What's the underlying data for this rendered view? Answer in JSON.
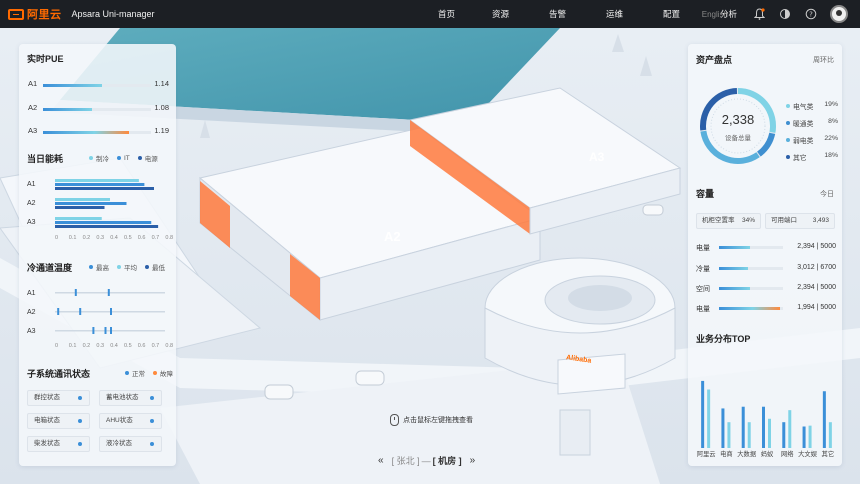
{
  "header": {
    "logo_text": "阿里云",
    "product_name": "Apsara Uni-manager",
    "nav": [
      "首页",
      "资源",
      "告警",
      "运维",
      "配置",
      "分析"
    ],
    "language": "English"
  },
  "left": {
    "pue": {
      "title": "实时PUE",
      "rows": [
        {
          "label": "A1",
          "value": "1.14",
          "fraction": 0.55
        },
        {
          "label": "A2",
          "value": "1.08",
          "fraction": 0.45
        },
        {
          "label": "A3",
          "value": "1.19",
          "fraction": 0.8
        }
      ]
    },
    "energy": {
      "title": "当日能耗",
      "legend": [
        "制冷",
        "IT",
        "电源"
      ],
      "rows": [
        {
          "label": "A1",
          "values": [
            0.61,
            0.65,
            0.72
          ]
        },
        {
          "label": "A2",
          "values": [
            0.4,
            0.52,
            0.36
          ]
        },
        {
          "label": "A3",
          "values": [
            0.34,
            0.7,
            0.75
          ]
        }
      ],
      "ticks": [
        "0",
        "0.1",
        "0.2",
        "0.3",
        "0.4",
        "0.5",
        "0.6",
        "0.7",
        "0.8"
      ]
    },
    "cold_aisle": {
      "title": "冷通道温度",
      "legend": [
        "最高",
        "平均",
        "最低"
      ],
      "rows": [
        {
          "label": "A1",
          "markers": [
            0.18,
            0.48
          ]
        },
        {
          "label": "A2",
          "markers": [
            0.02,
            0.22,
            0.5
          ]
        },
        {
          "label": "A3",
          "markers": [
            0.34,
            0.45,
            0.5
          ]
        }
      ],
      "ticks": [
        "0",
        "0.1",
        "0.2",
        "0.3",
        "0.4",
        "0.5",
        "0.6",
        "0.7",
        "0.8"
      ]
    },
    "subsystem": {
      "title": "子系统通讯状态",
      "legend": [
        "正常",
        "故障"
      ],
      "items": [
        "群控状态",
        "蓄电池状态",
        "电箱状态",
        "AHU状态",
        "柴发状态",
        "液冷状态"
      ]
    }
  },
  "right": {
    "assets": {
      "title": "资产盘点",
      "toggle": "周环比",
      "total": "2,338",
      "total_label": "设备总量",
      "legend": [
        {
          "name": "电气类",
          "pct": "19%",
          "value": 19,
          "color": "#7fd3e6"
        },
        {
          "name": "暖通类",
          "pct": "8%",
          "value": 8,
          "color": "#3f8fd0"
        },
        {
          "name": "弱电类",
          "pct": "22%",
          "value": 22,
          "color": "#5ab0dc"
        },
        {
          "name": "其它",
          "pct": "18%",
          "value": 18,
          "color": "#2b5fa8"
        }
      ]
    },
    "capacity": {
      "title": "容量",
      "period": "今日",
      "boxes": [
        {
          "label": "机柜空置率",
          "value": "34%"
        },
        {
          "label": "可用端口",
          "value": "3,493"
        }
      ],
      "rows": [
        {
          "label": "电量",
          "value": "2,394 | 5000",
          "fraction": 0.48
        },
        {
          "label": "冷量",
          "value": "3,012 | 6700",
          "fraction": 0.45
        },
        {
          "label": "空间",
          "value": "2,394 | 5000",
          "fraction": 0.48
        },
        {
          "label": "电量",
          "value": "1,994 | 5000",
          "fraction": 0.95
        }
      ]
    },
    "business": {
      "title": "业务分布TOP",
      "categories": [
        "阿里云",
        "电商",
        "大数据",
        "蚂蚁",
        "网络",
        "大文娱",
        "其它"
      ],
      "bars": [
        [
          0.78,
          0.68
        ],
        [
          0.46,
          0.3
        ],
        [
          0.48,
          0.3
        ],
        [
          0.48,
          0.34
        ],
        [
          0.3,
          0.44
        ],
        [
          0.25,
          0.26
        ],
        [
          0.66,
          0.3
        ]
      ]
    }
  },
  "scene": {
    "labels": {
      "a2": "A2",
      "a3": "A3",
      "sign": "Alibaba"
    },
    "hint": "点击鼠标左键拖拽查看",
    "breadcrumb": {
      "left": "[ 张北 ]",
      "sep": "—",
      "right": "[ 机房 ]"
    }
  },
  "colors": {
    "accent": "#ff6a00",
    "blue": "#3b8fd8",
    "teal": "#7fd3e6",
    "dark_blue": "#2b5fa8"
  }
}
